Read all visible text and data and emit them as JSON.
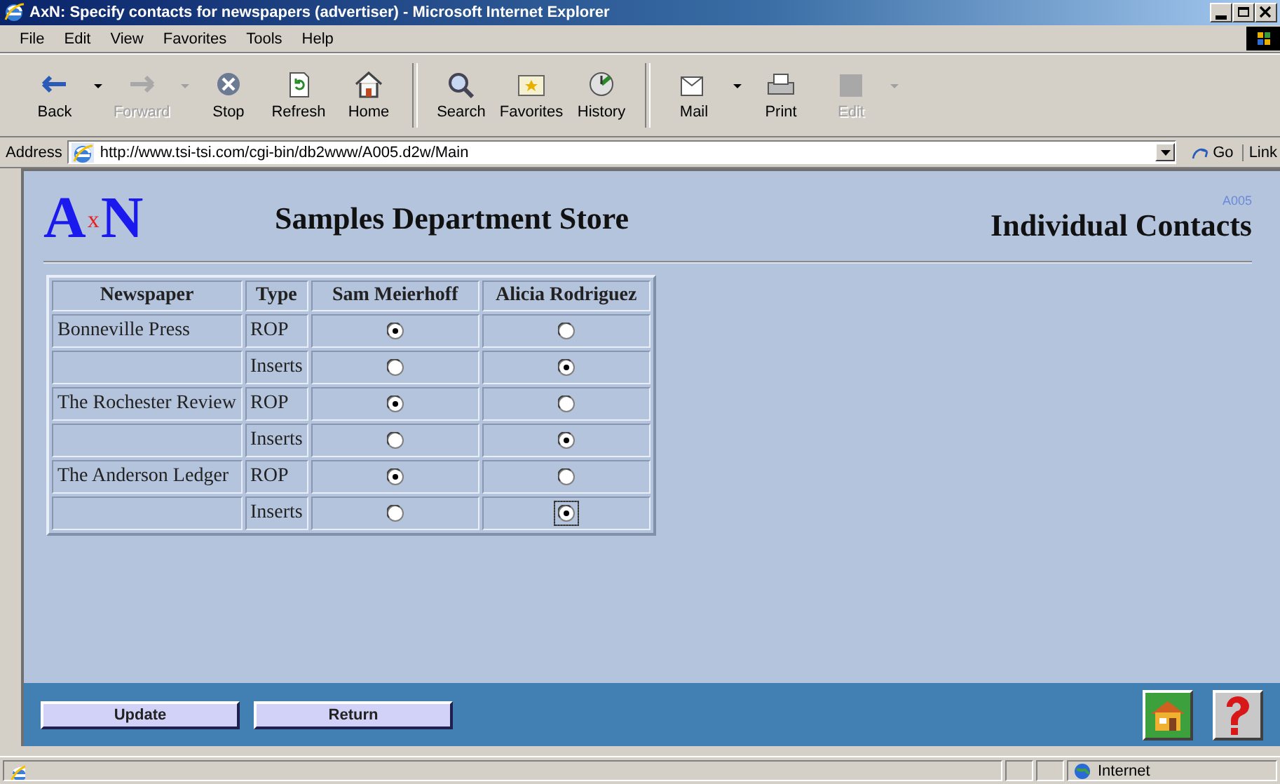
{
  "window": {
    "title": "AxN: Specify contacts for newspapers (advertiser) - Microsoft Internet Explorer"
  },
  "menu": [
    "File",
    "Edit",
    "View",
    "Favorites",
    "Tools",
    "Help"
  ],
  "toolbar": [
    {
      "label": "Back",
      "kind": "back",
      "disabled": false,
      "dropdown": true
    },
    {
      "label": "Forward",
      "kind": "forward",
      "disabled": true,
      "dropdown": true
    },
    {
      "label": "Stop",
      "kind": "stop",
      "disabled": false,
      "dropdown": false
    },
    {
      "label": "Refresh",
      "kind": "refresh",
      "disabled": false,
      "dropdown": false
    },
    {
      "label": "Home",
      "kind": "home",
      "disabled": false,
      "dropdown": false
    },
    {
      "label": "Search",
      "kind": "search",
      "disabled": false,
      "dropdown": false
    },
    {
      "label": "Favorites",
      "kind": "favorites",
      "disabled": false,
      "dropdown": false
    },
    {
      "label": "History",
      "kind": "history",
      "disabled": false,
      "dropdown": false
    },
    {
      "label": "Mail",
      "kind": "mail",
      "disabled": false,
      "dropdown": true
    },
    {
      "label": "Print",
      "kind": "print",
      "disabled": false,
      "dropdown": false
    },
    {
      "label": "Edit",
      "kind": "edit",
      "disabled": true,
      "dropdown": true
    }
  ],
  "address": {
    "label": "Address",
    "url": "http://www.tsi-tsi.com/cgi-bin/db2www/A005.d2w/Main",
    "go": "Go",
    "links": "Link"
  },
  "page": {
    "logo": [
      "A",
      "x",
      "N"
    ],
    "store": "Samples Department Store",
    "code": "A005",
    "title": "Individual Contacts",
    "table": {
      "columns": [
        "Newspaper",
        "Type",
        "Sam Meierhoff",
        "Alicia Rodriguez"
      ],
      "rows": [
        {
          "newspaper": "Bonneville Press",
          "type": "ROP",
          "choices": [
            {
              "selected": true,
              "focused": false
            },
            {
              "selected": false,
              "focused": false
            }
          ]
        },
        {
          "type": "Inserts",
          "choices": [
            {
              "selected": false,
              "focused": false
            },
            {
              "selected": true,
              "focused": false
            }
          ]
        },
        {
          "newspaper": "The Rochester Review",
          "type": "ROP",
          "choices": [
            {
              "selected": true,
              "focused": false
            },
            {
              "selected": false,
              "focused": false
            }
          ]
        },
        {
          "type": "Inserts",
          "choices": [
            {
              "selected": false,
              "focused": false
            },
            {
              "selected": true,
              "focused": false
            }
          ]
        },
        {
          "newspaper": "The Anderson Ledger",
          "type": "ROP",
          "choices": [
            {
              "selected": true,
              "focused": false
            },
            {
              "selected": false,
              "focused": false
            }
          ]
        },
        {
          "type": "Inserts",
          "choices": [
            {
              "selected": false,
              "focused": false
            },
            {
              "selected": true,
              "focused": true
            }
          ]
        }
      ]
    },
    "buttons": [
      "Update",
      "Return"
    ]
  },
  "status_bar": {
    "zone": "Internet"
  }
}
